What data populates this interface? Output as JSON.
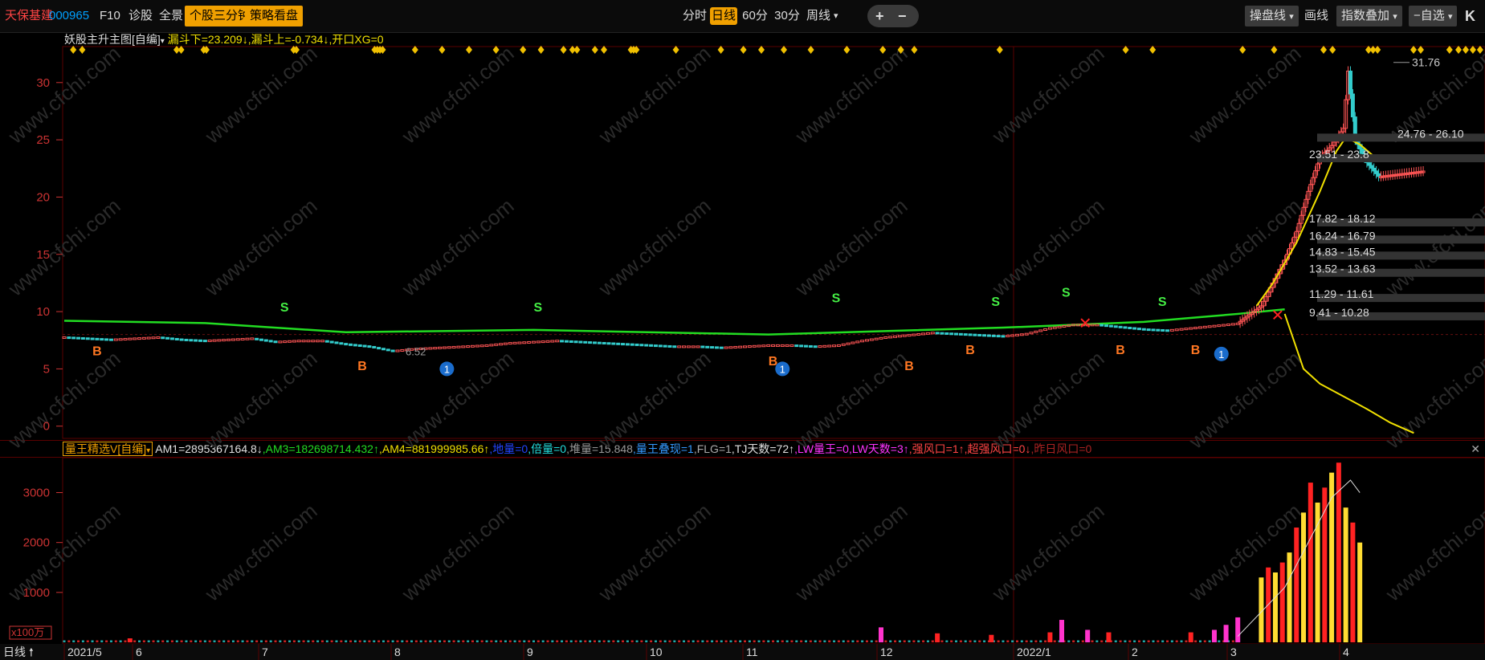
{
  "toolbar": {
    "stock_name": "天保基建",
    "stock_code": "000965",
    "f10": "F10",
    "diagnose": "诊股",
    "panorama": "全景",
    "three_min": "个股三分钟",
    "strategy": "策略看盘",
    "timeframes": [
      "分时",
      "日线",
      "60分",
      "30分",
      "周线"
    ],
    "active_timeframe": "日线",
    "plus": "+",
    "minus": "−",
    "trading_line": "操盘线",
    "draw_line": "画线",
    "index_overlay": "指数叠加",
    "watchlist": "−自选",
    "k": "K"
  },
  "main_indicator": {
    "name": "妖股主升主图[自编]",
    "values": [
      {
        "text": "漏斗下=23.209↓",
        "color": "#f0e000"
      },
      {
        "text": ",漏斗上=-0.734↓",
        "color": "#f0e000"
      },
      {
        "text": ",开口XG=0",
        "color": "#f0e000"
      }
    ]
  },
  "sub_indicator": {
    "name": "量王精选V[自编]",
    "values": [
      {
        "text": "AM1=2895367164.8↓",
        "color": "#e0e0e0"
      },
      {
        "text": ",AM3=182698714.432↑",
        "color": "#22dd22"
      },
      {
        "text": ",AM4=881999985.66↑",
        "color": "#f0e000"
      },
      {
        "text": ",地量=0",
        "color": "#2244ff"
      },
      {
        "text": ",倍量=0",
        "color": "#22dddd"
      },
      {
        "text": ",堆量=15.848",
        "color": "#999999"
      },
      {
        "text": ",量王叠现=1",
        "color": "#3399ff"
      },
      {
        "text": ",FLG=1",
        "color": "#aaaaaa"
      },
      {
        "text": ",TJ天数=72↑",
        "color": "#e0e0e0"
      },
      {
        "text": ",LW量王=0",
        "color": "#ff33ff"
      },
      {
        "text": ",LW天数=3↑",
        "color": "#ff33ff"
      },
      {
        "text": ",强风口=1↑",
        "color": "#ff4444"
      },
      {
        "text": ",超强风口=0↓",
        "color": "#ff4444"
      },
      {
        "text": ",昨日风口=0",
        "color": "#aa2222"
      }
    ],
    "close": "✕"
  },
  "bottom": {
    "period": "日线",
    "unit": "x100万",
    "dates": [
      "2021/5",
      "6",
      "7",
      "8",
      "9",
      "10",
      "11",
      "12",
      "2022/1",
      "2",
      "3",
      "4"
    ]
  },
  "chart_data": [
    {
      "type": "candlestick",
      "y_ticks": [
        "30",
        "25",
        "20",
        "15",
        "10",
        "5",
        "0"
      ],
      "ylim": [
        -1,
        33
      ],
      "price_labels": [
        "31.76",
        "24.76 - 26.10",
        "23.51 - 23.8",
        "17.82 - 18.12",
        "16.24 - 16.79",
        "14.83 - 15.45",
        "13.52 - 13.63",
        "11.29 - 11.61",
        "9.41 - 10.28",
        "6.52"
      ],
      "price_label_values": [
        31.76,
        25.4,
        23.6,
        18.0,
        16.5,
        15.1,
        13.6,
        11.4,
        9.8,
        6.52
      ],
      "signals_B": [
        "B",
        "B",
        "B",
        "B",
        "B",
        "B",
        "B"
      ],
      "signals_S": [
        "S",
        "S",
        "S",
        "S",
        "S",
        "S"
      ],
      "signal_1": [
        "1",
        "1",
        "1"
      ],
      "close_path": [
        [
          0,
          7.8
        ],
        [
          10,
          7.7
        ],
        [
          20,
          7.6
        ],
        [
          30,
          7.7
        ],
        [
          40,
          7.8
        ],
        [
          50,
          7.6
        ],
        [
          60,
          7.5
        ],
        [
          70,
          7.6
        ],
        [
          80,
          7.7
        ],
        [
          90,
          7.4
        ],
        [
          100,
          7.5
        ],
        [
          110,
          7.5
        ],
        [
          120,
          7.2
        ],
        [
          130,
          7.0
        ],
        [
          140,
          6.6
        ],
        [
          150,
          6.8
        ],
        [
          160,
          6.9
        ],
        [
          170,
          7.0
        ],
        [
          180,
          7.1
        ],
        [
          190,
          7.3
        ],
        [
          200,
          7.4
        ],
        [
          210,
          7.5
        ],
        [
          220,
          7.4
        ],
        [
          230,
          7.3
        ],
        [
          240,
          7.2
        ],
        [
          250,
          7.1
        ],
        [
          260,
          7.0
        ],
        [
          270,
          7.0
        ],
        [
          280,
          6.9
        ],
        [
          290,
          7.0
        ],
        [
          300,
          7.1
        ],
        [
          310,
          7.1
        ],
        [
          320,
          7.0
        ],
        [
          330,
          7.1
        ],
        [
          340,
          7.5
        ],
        [
          350,
          7.8
        ],
        [
          360,
          8.0
        ],
        [
          370,
          8.2
        ],
        [
          380,
          8.1
        ],
        [
          390,
          8.0
        ],
        [
          400,
          7.9
        ],
        [
          410,
          8.1
        ],
        [
          420,
          8.6
        ],
        [
          430,
          8.9
        ],
        [
          440,
          8.9
        ],
        [
          450,
          8.7
        ],
        [
          460,
          8.5
        ],
        [
          470,
          8.4
        ],
        [
          480,
          8.6
        ],
        [
          490,
          8.8
        ],
        [
          500,
          9.0
        ],
        [
          510,
          10.5
        ],
        [
          515,
          12.5
        ],
        [
          520,
          14.5
        ],
        [
          525,
          17.0
        ],
        [
          530,
          20.5
        ],
        [
          535,
          23.5
        ],
        [
          540,
          24.5
        ],
        [
          545,
          26.0
        ],
        [
          547,
          31.0
        ],
        [
          550,
          25.0
        ],
        [
          555,
          23.0
        ],
        [
          560,
          21.8
        ]
      ],
      "green_line": [
        [
          0,
          9.2
        ],
        [
          60,
          9.0
        ],
        [
          120,
          8.2
        ],
        [
          200,
          8.4
        ],
        [
          300,
          8.0
        ],
        [
          400,
          8.6
        ],
        [
          460,
          9.1
        ],
        [
          500,
          9.8
        ],
        [
          520,
          10.2
        ]
      ],
      "yellow_line": [
        [
          508,
          10.5
        ],
        [
          515,
          12.5
        ],
        [
          525,
          16.0
        ],
        [
          535,
          20.5
        ],
        [
          542,
          24.0
        ],
        [
          546,
          25.2
        ],
        [
          552,
          24.6
        ],
        [
          560,
          23.2
        ]
      ],
      "yellow_drop": [
        [
          520,
          9.8
        ],
        [
          528,
          5.0
        ],
        [
          535,
          3.7
        ],
        [
          545,
          2.6
        ],
        [
          555,
          1.5
        ],
        [
          565,
          0.3
        ],
        [
          575,
          -0.6
        ]
      ]
    },
    {
      "type": "bar",
      "y_ticks": [
        "3000",
        "2000",
        "1000"
      ],
      "ylim": [
        0,
        3700
      ],
      "volume_spikes": [
        [
          28,
          80
        ],
        [
          348,
          300
        ],
        [
          372,
          180
        ],
        [
          395,
          150
        ],
        [
          420,
          200
        ],
        [
          425,
          450
        ],
        [
          436,
          250
        ],
        [
          445,
          200
        ],
        [
          480,
          200
        ],
        [
          490,
          250
        ],
        [
          495,
          350
        ],
        [
          500,
          500
        ],
        [
          510,
          1300
        ],
        [
          513,
          1500
        ],
        [
          516,
          1400
        ],
        [
          519,
          1600
        ],
        [
          522,
          1800
        ],
        [
          525,
          2300
        ],
        [
          528,
          2600
        ],
        [
          531,
          3200
        ],
        [
          534,
          2800
        ],
        [
          537,
          3100
        ],
        [
          540,
          3400
        ],
        [
          543,
          3600
        ],
        [
          546,
          2700
        ],
        [
          549,
          2400
        ],
        [
          552,
          2000
        ]
      ]
    }
  ]
}
